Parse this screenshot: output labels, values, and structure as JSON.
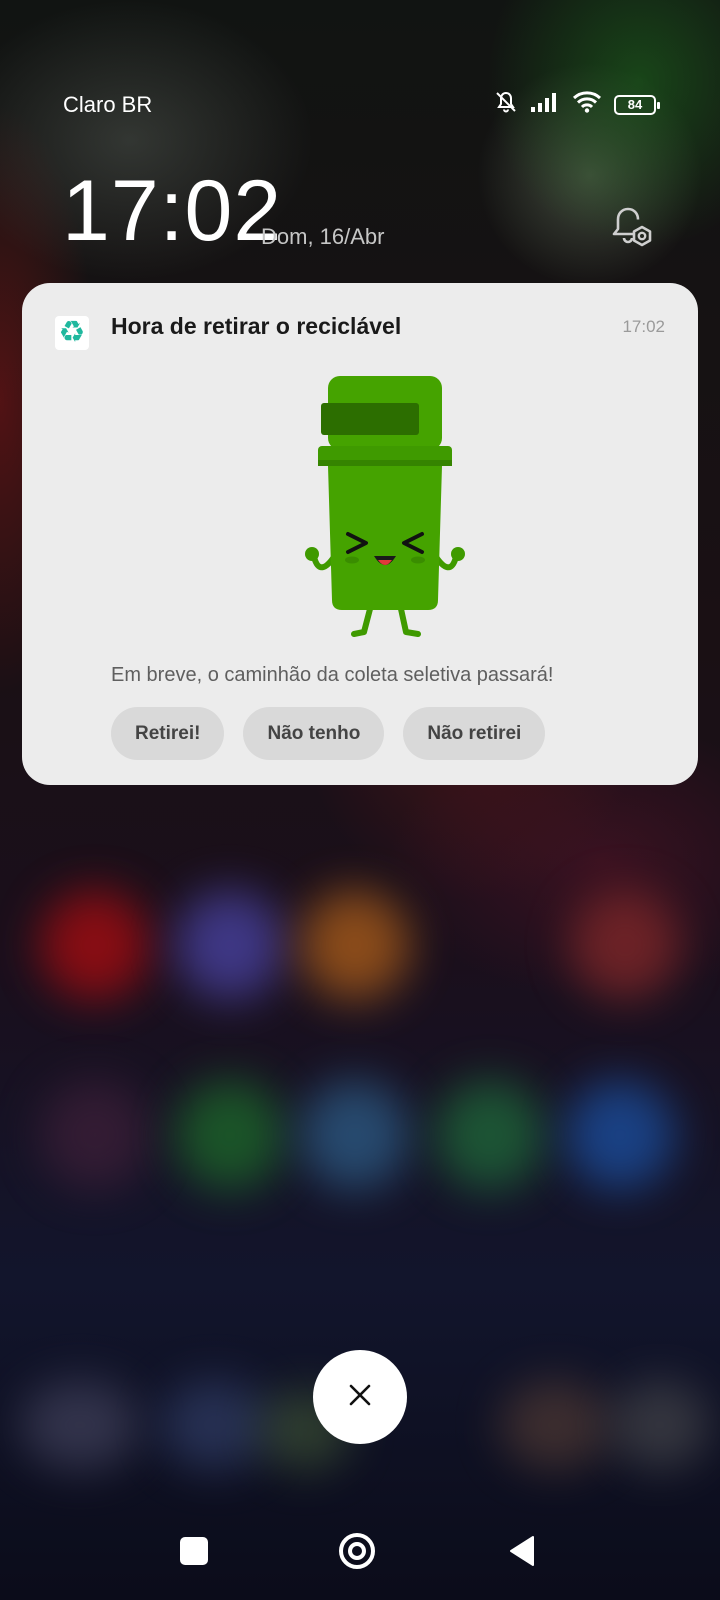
{
  "status_bar": {
    "carrier": "Claro BR",
    "battery": "84",
    "icons": [
      "mute-bell-icon",
      "signal-icon",
      "wifi-icon",
      "battery-icon"
    ]
  },
  "lockscreen": {
    "time": "17:02",
    "date": "Dom, 16/Abr"
  },
  "notification": {
    "app_icon": "recycle-icon",
    "title": "Hora de retirar o reciclável",
    "time": "17:02",
    "body": "Em breve, o caminhão da coleta seletiva passará!",
    "actions": [
      "Retirei!",
      "Não tenho",
      "Não retirei"
    ],
    "accent_color": "#43a000"
  },
  "dismiss": {
    "icon": "close-icon"
  },
  "navbar": {
    "icons": [
      "recents-square-icon",
      "home-circle-icon",
      "back-triangle-icon"
    ]
  }
}
